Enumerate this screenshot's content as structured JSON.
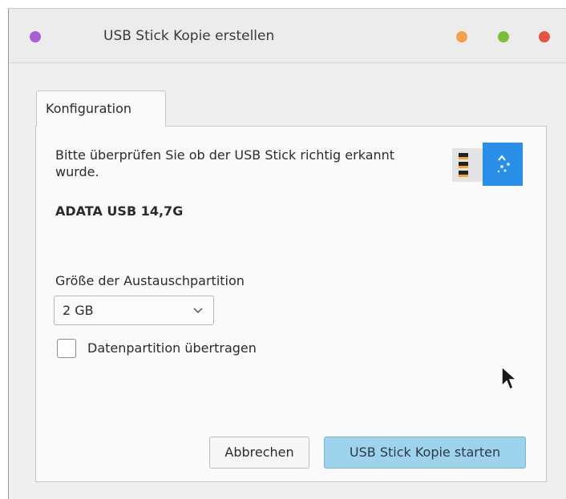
{
  "window": {
    "title": "USB Stick Kopie erstellen",
    "colors": {
      "menu_dot": "#a65fd6",
      "minimize": "#f6a04d",
      "maximize": "#79c03a",
      "close": "#e5563f"
    }
  },
  "tabs": [
    {
      "label": "Konfiguration",
      "active": true
    }
  ],
  "config": {
    "info_text": "Bitte überprüfen Sie ob der USB Stick richtig erkannt wurde.",
    "device_name": "ADATA USB 14,7G",
    "device_icon": "usb-stick-icon",
    "swap_size_label": "Größe der Austauschpartition",
    "swap_size_value": "2 GB",
    "data_partition_label": "Datenpartition übertragen",
    "data_partition_checked": false
  },
  "buttons": {
    "cancel": "Abbrechen",
    "start": "USB Stick Kopie starten",
    "start_color": "#9ed3ee"
  }
}
